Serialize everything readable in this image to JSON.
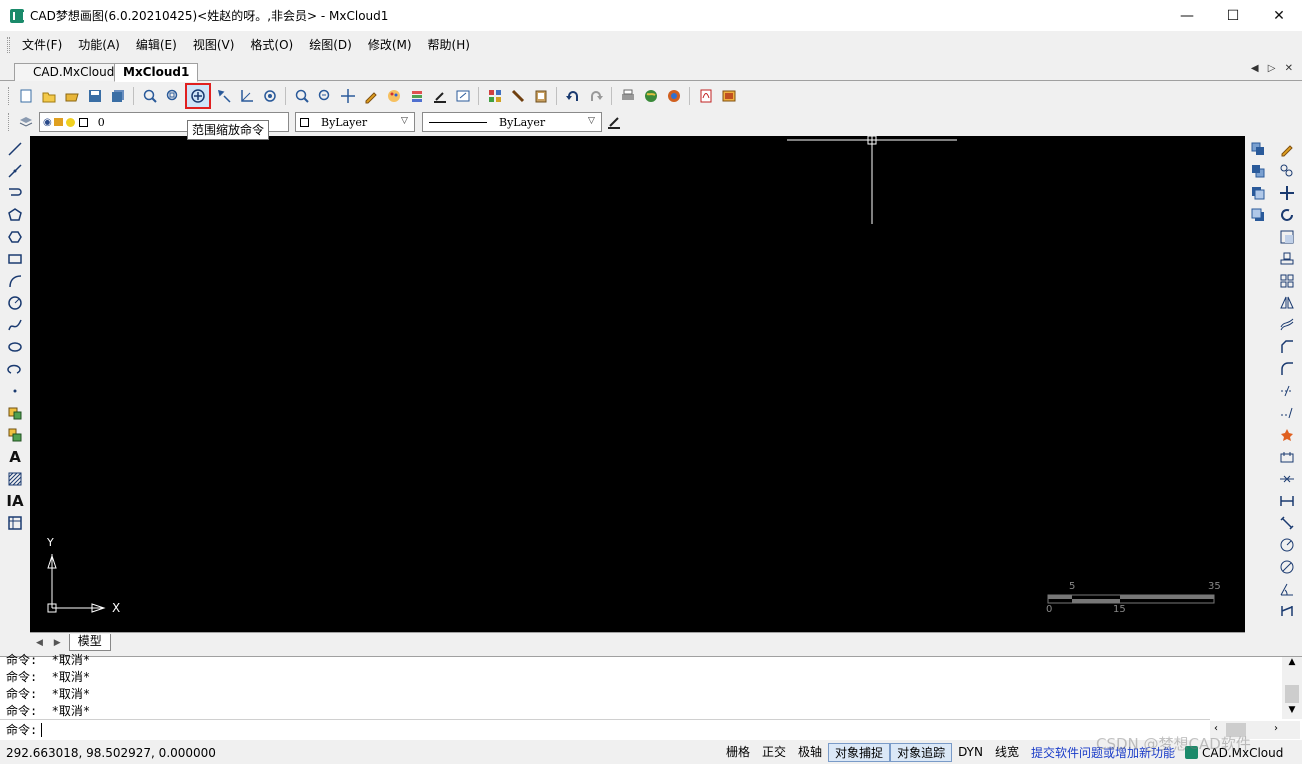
{
  "window": {
    "title": "CAD梦想画图(6.0.20210425)<姓赵的呀。,非会员> - MxCloud1",
    "minimize": "—",
    "maximize": "☐",
    "close": "✕"
  },
  "menu": {
    "items": [
      "文件(F)",
      "功能(A)",
      "编辑(E)",
      "视图(V)",
      "格式(O)",
      "绘图(D)",
      "修改(M)",
      "帮助(H)"
    ]
  },
  "tabs": {
    "items": [
      "CAD.MxCloud",
      "MxCloud1"
    ],
    "active_index": 1,
    "nav": "◀ ▷ ✕"
  },
  "toolbar": {
    "layer_value": "0",
    "color_value": "ByLayer",
    "linetype_value": "ByLayer",
    "tooltip": "范围缩放命令"
  },
  "canvas": {
    "ucs_x": "X",
    "ucs_y": "Y",
    "scale_labels_top": [
      "5",
      "35"
    ],
    "scale_labels_bottom": [
      "0",
      "15"
    ]
  },
  "sheet": {
    "nav": "◀ ▶",
    "tab_label": "模型"
  },
  "command": {
    "history": [
      "命令:  *取消*",
      "命令:  *取消*",
      "命令:  *取消*",
      "命令:  *取消*"
    ],
    "prompt": "命令:"
  },
  "status": {
    "coords": "292.663018,  98.502927,  0.000000",
    "toggles": [
      {
        "label": "栅格",
        "on": false
      },
      {
        "label": "正交",
        "on": false
      },
      {
        "label": "极轴",
        "on": false
      },
      {
        "label": "对象捕捉",
        "on": true
      },
      {
        "label": "对象追踪",
        "on": true
      },
      {
        "label": "DYN",
        "on": false
      },
      {
        "label": "线宽",
        "on": false
      }
    ],
    "link": "提交软件问题或增加新功能",
    "brand": "CAD.MxCloud"
  },
  "watermark": "CSDN @梦想CAD软件"
}
